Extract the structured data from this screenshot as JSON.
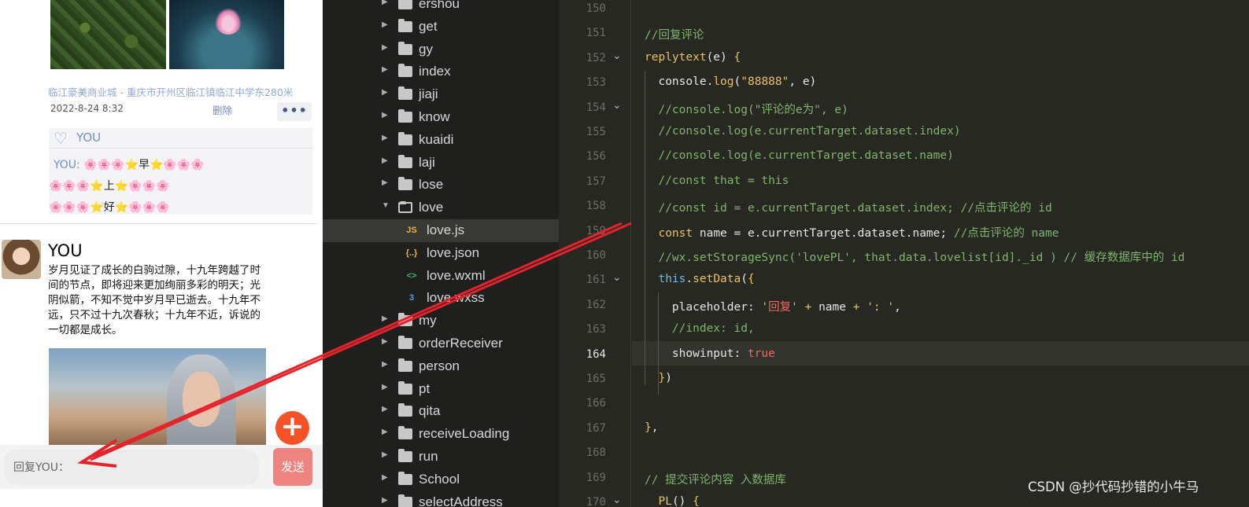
{
  "phone": {
    "location": "临江豪美商业城 - 重庆市开州区临江镇临江中学东280米",
    "post_time": "2022-8-24 8:32",
    "delete_label": "删除",
    "more_label": "•••",
    "likes_name": "YOU",
    "reply_name": "YOU:",
    "reply_lines": [
      "🌸🌸🌸⭐早⭐🌸🌸🌸",
      "🌸🌸🌸⭐上⭐🌸🌸🌸",
      "🌸🌸🌸⭐好⭐🌸🌸🌸"
    ],
    "post_author": "YOU",
    "post_text": "岁月见证了成长的白驹过隙，十九年跨越了时间的节点，即将迎来更加绚丽多彩的明天；光阴似箭，不知不觉中岁月早已逝去。十九年不远，只不过十九次春秋；十九年不近，诉说的一切都是成长。",
    "fab_label": "+",
    "reply_placeholder": "回复YOU：",
    "send_label": "发送"
  },
  "explorer": {
    "items": [
      {
        "label": "ershou",
        "kind": "folder",
        "expanded": false
      },
      {
        "label": "get",
        "kind": "folder",
        "expanded": false
      },
      {
        "label": "gy",
        "kind": "folder",
        "expanded": false
      },
      {
        "label": "index",
        "kind": "folder",
        "expanded": false
      },
      {
        "label": "jiaji",
        "kind": "folder",
        "expanded": false
      },
      {
        "label": "know",
        "kind": "folder",
        "expanded": false
      },
      {
        "label": "kuaidi",
        "kind": "folder",
        "expanded": false
      },
      {
        "label": "laji",
        "kind": "folder",
        "expanded": false
      },
      {
        "label": "lose",
        "kind": "folder",
        "expanded": false
      },
      {
        "label": "love",
        "kind": "folder",
        "expanded": true
      },
      {
        "label": "love.js",
        "kind": "js",
        "selected": true
      },
      {
        "label": "love.json",
        "kind": "json"
      },
      {
        "label": "love.wxml",
        "kind": "wxml"
      },
      {
        "label": "love.wxss",
        "kind": "wxss"
      },
      {
        "label": "my",
        "kind": "folder",
        "expanded": false
      },
      {
        "label": "orderReceiver",
        "kind": "folder",
        "expanded": false
      },
      {
        "label": "person",
        "kind": "folder",
        "expanded": false
      },
      {
        "label": "pt",
        "kind": "folder",
        "expanded": false
      },
      {
        "label": "qita",
        "kind": "folder",
        "expanded": false
      },
      {
        "label": "receiveLoading",
        "kind": "folder",
        "expanded": false
      },
      {
        "label": "run",
        "kind": "folder",
        "expanded": false
      },
      {
        "label": "School",
        "kind": "folder",
        "expanded": false
      },
      {
        "label": "selectAddress",
        "kind": "folder",
        "expanded": false
      }
    ],
    "icons": {
      "js": "JS",
      "json": "{..}",
      "wxml": "<>",
      "wxss": "3"
    }
  },
  "editor": {
    "current_line": "164",
    "lines": [
      {
        "no": "150",
        "html": ""
      },
      {
        "no": "151",
        "html": "<span class=\"c-comment\">//回复评论</span>"
      },
      {
        "no": "152",
        "fold": true,
        "html": "<span class=\"c-fn\">replytext</span>(e) <span class=\"c-brace\">{</span>"
      },
      {
        "no": "153",
        "html": "  console.<span class=\"c-fn\">log</span>(<span class=\"c-str\">\"88888\"</span>, e)"
      },
      {
        "no": "154",
        "fold": true,
        "html": "  <span class=\"c-comment\">//console.log(\"评论的e为\", e)</span>"
      },
      {
        "no": "155",
        "html": "  <span class=\"c-comment\">//console.log(e.currentTarget.dataset.index)</span>"
      },
      {
        "no": "156",
        "html": "  <span class=\"c-comment\">//console.log(e.currentTarget.dataset.name)</span>"
      },
      {
        "no": "157",
        "html": "  <span class=\"c-comment\">//const that = this</span>"
      },
      {
        "no": "158",
        "html": "  <span class=\"c-comment\">//const id = e.currentTarget.dataset.index; //点击评论的 id</span>"
      },
      {
        "no": "159",
        "html": "  <span class=\"c-kw\">const</span> name = e.currentTarget.dataset.name; <span class=\"c-comment\">//点击评论的 name</span>"
      },
      {
        "no": "160",
        "html": "  <span class=\"c-comment\">//wx.setStorageSync('lovePL', that.data.lovelist[id]._id ) // 缓存数据库中的 id</span>"
      },
      {
        "no": "161",
        "fold": true,
        "html": "  <span class=\"c-blue\">this</span>.<span class=\"c-fn\">setData</span>(<span class=\"c-brace\">{</span>"
      },
      {
        "no": "162",
        "html": "    placeholder: <span class=\"c-str\">'<span class=\"c-red\">回复</span>'</span> <span class=\"c-fn\">+</span> name <span class=\"c-fn\">+</span> <span class=\"c-str\">': '</span>,"
      },
      {
        "no": "163",
        "html": "    <span class=\"c-comment\">//index: id,</span>"
      },
      {
        "no": "164",
        "html": "    showinput: <span class=\"c-red\">true</span>"
      },
      {
        "no": "165",
        "html": "  <span class=\"c-brace\">}</span>)"
      },
      {
        "no": "166",
        "html": ""
      },
      {
        "no": "167",
        "html": "<span class=\"c-brace\">}</span>,"
      },
      {
        "no": "168",
        "html": ""
      },
      {
        "no": "169",
        "html": "<span class=\"c-comment\">// 提交评论内容 入数据库</span>"
      },
      {
        "no": "170",
        "fold": true,
        "html": "  <span class=\"c-fn\">PL</span>() <span class=\"c-brace\">{</span>"
      }
    ]
  },
  "watermark": "CSDN @抄代码抄错的小牛马",
  "colors": {
    "accent": "#f5522a",
    "send": "#ee8480",
    "arrow": "#e3242b",
    "ide_bg": "#272822"
  }
}
